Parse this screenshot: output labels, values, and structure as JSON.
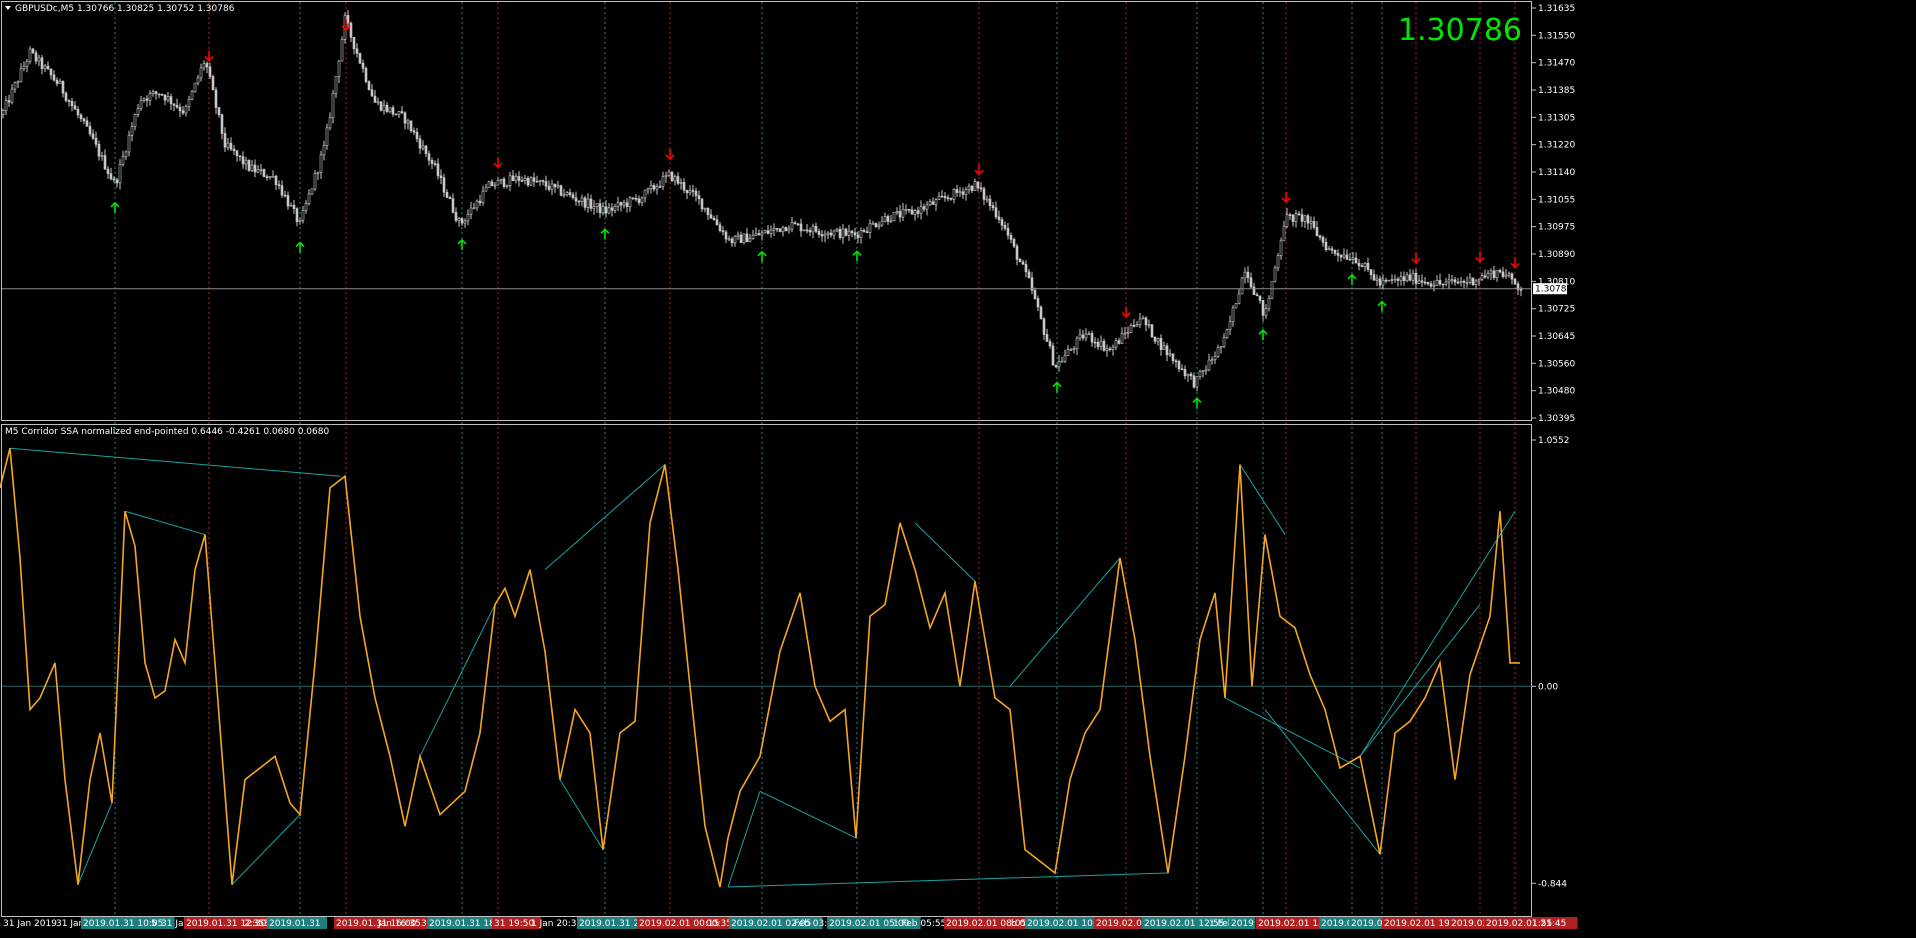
{
  "main": {
    "title": "GBPUSDc,M5  1.30766 1.30825 1.30752 1.30786",
    "big_price": "1.30786",
    "price_label": "1.30786",
    "price_line_value": 1.30786
  },
  "indicator": {
    "title": "M5 Corridor SSA normalized end-pointed 0.6446 -0.4261 0.0680 0.0680"
  },
  "colors": {
    "background": "#000000",
    "frame": "#c0c0c0",
    "candle": "#c8c8c8",
    "green_arrow": "#00e600",
    "red_arrow": "#ff0000",
    "osc_line": "#f5a623",
    "trend_line": "#1aa3a3",
    "teal_vline": "#1f8a8a",
    "red_vline": "#b42020",
    "big_price": "#00e600",
    "price_line": "#8c8c8c"
  },
  "chart_data": [
    {
      "type": "line",
      "name": "price",
      "y_ticks": [
        "1.31635",
        "1.31550",
        "1.31470",
        "1.31385",
        "1.31305",
        "1.31220",
        "1.31140",
        "1.31055",
        "1.30975",
        "1.30890",
        "1.30810",
        "1.30725",
        "1.30645",
        "1.30560",
        "1.30480",
        "1.30395"
      ],
      "ylim": [
        1.30395,
        1.31635
      ],
      "x": [
        0,
        30,
        60,
        90,
        115,
        140,
        160,
        185,
        205,
        225,
        250,
        275,
        300,
        325,
        345,
        375,
        405,
        435,
        460,
        490,
        520,
        545,
        575,
        605,
        640,
        670,
        700,
        730,
        760,
        790,
        820,
        855,
        885,
        915,
        945,
        975,
        1000,
        1030,
        1055,
        1085,
        1110,
        1140,
        1165,
        1195,
        1225,
        1245,
        1265,
        1285,
        1305,
        1330,
        1355,
        1380,
        1410,
        1440,
        1470,
        1500,
        1520
      ],
      "close": [
        1.313,
        1.315,
        1.314,
        1.3125,
        1.311,
        1.3136,
        1.3138,
        1.3132,
        1.3148,
        1.3122,
        1.3115,
        1.3112,
        1.3098,
        1.3122,
        1.316,
        1.3135,
        1.313,
        1.3115,
        1.3098,
        1.311,
        1.3112,
        1.311,
        1.3106,
        1.3102,
        1.3106,
        1.3113,
        1.3105,
        1.3093,
        1.3095,
        1.3098,
        1.3096,
        1.3095,
        1.31,
        1.3102,
        1.3106,
        1.311,
        1.31,
        1.308,
        1.3055,
        1.3065,
        1.306,
        1.307,
        1.306,
        1.305,
        1.3063,
        1.3085,
        1.307,
        1.31,
        1.31,
        1.309,
        1.3088,
        1.308,
        1.3082,
        1.308,
        1.3081,
        1.3084,
        1.3079
      ],
      "green_arrows": [
        115,
        300,
        462,
        605,
        762,
        857,
        1057,
        1197,
        1263,
        1352,
        1382
      ],
      "red_arrows": [
        209,
        346,
        498,
        670,
        979,
        1126,
        1286,
        1416,
        1480,
        1515
      ]
    },
    {
      "type": "line",
      "name": "oscillator",
      "y_ticks": [
        "1.0552",
        "0.00",
        "-0.844"
      ],
      "ylim": [
        -0.95,
        1.0552
      ],
      "x": [
        0,
        10,
        20,
        30,
        40,
        55,
        65,
        78,
        90,
        100,
        112,
        125,
        135,
        145,
        155,
        165,
        175,
        185,
        195,
        205,
        215,
        232,
        245,
        260,
        275,
        290,
        300,
        315,
        330,
        345,
        360,
        375,
        390,
        405,
        420,
        440,
        465,
        480,
        495,
        505,
        515,
        530,
        545,
        560,
        575,
        590,
        603,
        620,
        635,
        650,
        665,
        678,
        690,
        705,
        720,
        728,
        740,
        760,
        780,
        800,
        815,
        830,
        845,
        856,
        870,
        885,
        900,
        915,
        930,
        945,
        960,
        975,
        985,
        995,
        1010,
        1025,
        1040,
        1055,
        1070,
        1085,
        1100,
        1120,
        1135,
        1150,
        1168,
        1185,
        1200,
        1215,
        1225,
        1240,
        1252,
        1265,
        1280,
        1295,
        1310,
        1325,
        1340,
        1360,
        1380,
        1395,
        1410,
        1425,
        1440,
        1455,
        1470,
        1490,
        1500,
        1510,
        1520
      ],
      "y": [
        0.85,
        1.02,
        0.55,
        -0.1,
        -0.05,
        0.1,
        -0.4,
        -0.85,
        -0.4,
        -0.2,
        -0.5,
        0.75,
        0.6,
        0.1,
        -0.05,
        -0.02,
        0.2,
        0.1,
        0.5,
        0.65,
        0.1,
        -0.85,
        -0.4,
        -0.35,
        -0.3,
        -0.5,
        -0.55,
        0.1,
        0.85,
        0.9,
        0.3,
        -0.05,
        -0.3,
        -0.6,
        -0.3,
        -0.55,
        -0.45,
        -0.2,
        0.35,
        0.42,
        0.3,
        0.5,
        0.15,
        -0.4,
        -0.1,
        -0.2,
        -0.7,
        -0.2,
        -0.15,
        0.7,
        0.95,
        0.5,
        0.0,
        -0.6,
        -0.86,
        -0.65,
        -0.45,
        -0.3,
        0.15,
        0.4,
        0.0,
        -0.15,
        -0.1,
        -0.65,
        0.3,
        0.35,
        0.7,
        0.5,
        0.25,
        0.4,
        0.0,
        0.45,
        0.2,
        -0.05,
        -0.1,
        -0.7,
        -0.75,
        -0.8,
        -0.4,
        -0.2,
        -0.1,
        0.55,
        0.2,
        -0.3,
        -0.8,
        -0.3,
        0.2,
        0.4,
        -0.05,
        0.95,
        0.0,
        0.65,
        0.3,
        0.25,
        0.05,
        -0.1,
        -0.35,
        -0.3,
        -0.72,
        -0.2,
        -0.15,
        -0.05,
        0.1,
        -0.4,
        0.05,
        0.3,
        0.75,
        0.1,
        0.1
      ]
    }
  ],
  "x_axis": {
    "labels": [
      {
        "x": 2,
        "text": "31 Jan 2019",
        "bg": ""
      },
      {
        "x": 55,
        "text": "31 Jan 0",
        "bg": ""
      },
      {
        "x": 82,
        "text": "2019.01.31 10:05",
        "bg": "teal"
      },
      {
        "x": 150,
        "text": "5",
        "bg": ""
      },
      {
        "x": 160,
        "text": "31 Ja",
        "bg": ""
      },
      {
        "x": 185,
        "text": "2019.01.31 12:30",
        "bg": "red"
      },
      {
        "x": 243,
        "text": "2:35",
        "bg": ""
      },
      {
        "x": 262,
        "text": "3",
        "bg": ""
      },
      {
        "x": 268,
        "text": "2019.01.31",
        "bg": "teal"
      },
      {
        "x": 335,
        "text": "2019.01.31 16:00",
        "bg": "red"
      },
      {
        "x": 377,
        "text": "Jan 16:35",
        "bg": ""
      },
      {
        "x": 420,
        "text": "31",
        "bg": ""
      },
      {
        "x": 428,
        "text": "2019.01.31 18:55",
        "bg": "teal"
      },
      {
        "x": 493,
        "text": "31 19:50",
        "bg": "red"
      },
      {
        "x": 530,
        "text": "1 Jan 20:35",
        "bg": ""
      },
      {
        "x": 578,
        "text": "2019.01.31 22:35",
        "bg": "teal"
      },
      {
        "x": 638,
        "text": "2019.02.01 00:15",
        "bg": "red"
      },
      {
        "x": 705,
        "text": "00:35",
        "bg": ""
      },
      {
        "x": 730,
        "text": "2019.02.01 02:05",
        "bg": "teal"
      },
      {
        "x": 793,
        "text": "Feb 03:1",
        "bg": ""
      },
      {
        "x": 828,
        "text": "2019.02.01 05:00",
        "bg": "teal"
      },
      {
        "x": 892,
        "text": "1 Feb 05:55",
        "bg": ""
      },
      {
        "x": 945,
        "text": "2019.02.01 08:05",
        "bg": "red"
      },
      {
        "x": 1010,
        "text": "b 0",
        "bg": ""
      },
      {
        "x": 1026,
        "text": "2019.02.01 10:05",
        "bg": "teal"
      },
      {
        "x": 1095,
        "text": "2019.02.01",
        "bg": "red"
      },
      {
        "x": 1143,
        "text": "2019.02.01 12:55",
        "bg": "teal"
      },
      {
        "x": 1208,
        "text": "1 Feb",
        "bg": ""
      },
      {
        "x": 1230,
        "text": "2019",
        "bg": "teal"
      },
      {
        "x": 1257,
        "text": "2019.02.01 15:55",
        "bg": "red"
      },
      {
        "x": 1320,
        "text": "2019.02",
        "bg": "teal"
      },
      {
        "x": 1350,
        "text": "2019.02.0",
        "bg": "teal"
      },
      {
        "x": 1383,
        "text": "2019.02.01 19:15",
        "bg": "red"
      },
      {
        "x": 1450,
        "text": "2019.02.0",
        "bg": "red"
      },
      {
        "x": 1485,
        "text": "2019.02.01 21:45",
        "bg": "red"
      },
      {
        "x": 1531,
        "text": "1:55",
        "bg": ""
      }
    ]
  }
}
